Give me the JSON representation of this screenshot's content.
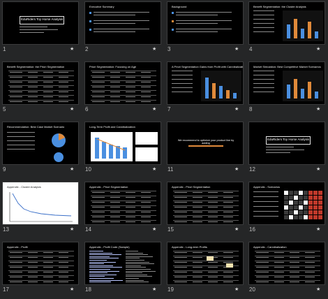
{
  "slides": [
    {
      "num": "1",
      "title": "EduRiders Toy Horse Analysis"
    },
    {
      "num": "2",
      "title": "Executive Summary"
    },
    {
      "num": "3",
      "title": "Background"
    },
    {
      "num": "4",
      "title": "Benefit Segmentation: the Cluster Analysis"
    },
    {
      "num": "5",
      "title": "Benefit Segmentation: the Priori Segmentation"
    },
    {
      "num": "6",
      "title": "Priori Segmentation: Focusing on Age"
    },
    {
      "num": "7",
      "title": "A Priori Segmentation Gains from Profit with Cannibalization"
    },
    {
      "num": "8",
      "title": "Market Simulation: Best Competitive Market Scenarios"
    },
    {
      "num": "9",
      "title": "Recommendation: Best Case Market Scenario"
    },
    {
      "num": "10",
      "title": "Long-Term Profit and Cannibalization"
    },
    {
      "num": "11",
      "title": "We recommend to optimize your product line by adding"
    },
    {
      "num": "12",
      "title": "EduRiders Toy Horse Analysis"
    },
    {
      "num": "13",
      "title": "Appendix - Cluster Analysis"
    },
    {
      "num": "14",
      "title": "Appendix - Priori Segmentation"
    },
    {
      "num": "15",
      "title": "Appendix - Priori Segmentation"
    },
    {
      "num": "16",
      "title": "Appendix - Scenarios"
    },
    {
      "num": "17",
      "title": "Appendix - Profit"
    },
    {
      "num": "18",
      "title": "Appendix - Profit Code (Sample)"
    },
    {
      "num": "19",
      "title": "Appendix - Long-term Profits"
    },
    {
      "num": "20",
      "title": "Appendix - Cannibalization"
    }
  ],
  "star_glyph": "★",
  "colors": {
    "background": "#252627",
    "slide": "#000000",
    "accent_blue": "#4a8fe0",
    "accent_orange": "#e08a3a"
  }
}
